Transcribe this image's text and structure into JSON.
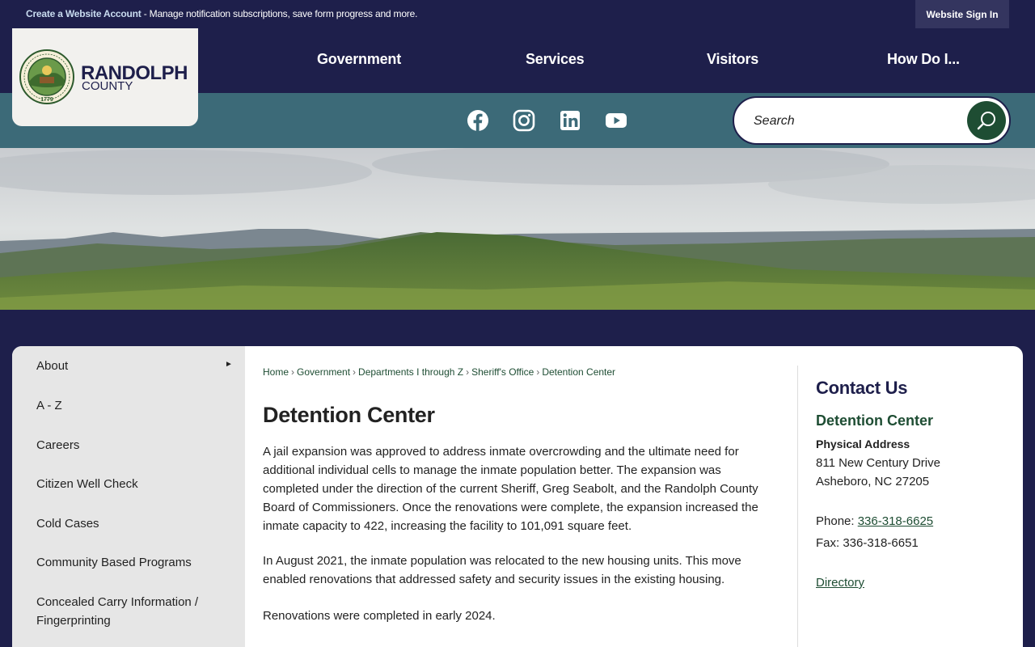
{
  "topbar": {
    "account_link": "Create a Website Account",
    "account_message": " - Manage notification subscriptions, save form progress and more.",
    "signin_label": "Website Sign In"
  },
  "logo": {
    "name": "RANDOLPH",
    "subname": "COUNTY",
    "seal_text": "RANDOLPH COUNTY, NORTH CAROLINA",
    "seal_year": "1779"
  },
  "nav": {
    "items": [
      {
        "label": "Government"
      },
      {
        "label": "Services"
      },
      {
        "label": "Visitors"
      },
      {
        "label": "How Do I..."
      }
    ]
  },
  "social": {
    "icons": [
      "facebook-icon",
      "instagram-icon",
      "linkedin-icon",
      "youtube-icon"
    ]
  },
  "search": {
    "placeholder": "Search"
  },
  "sidebar": {
    "items": [
      {
        "label": "About",
        "has_submenu": true
      },
      {
        "label": "A - Z"
      },
      {
        "label": "Careers"
      },
      {
        "label": "Citizen Well Check"
      },
      {
        "label": "Cold Cases"
      },
      {
        "label": "Community Based Programs"
      },
      {
        "label": "Concealed Carry Information / Fingerprinting"
      }
    ]
  },
  "breadcrumb": {
    "items": [
      "Home",
      "Government",
      "Departments I through Z",
      "Sheriff's Office",
      "Detention Center"
    ],
    "separator": "›"
  },
  "main": {
    "title": "Detention Center",
    "paragraphs": [
      "A jail expansion was approved to address inmate overcrowding and the ultimate need for additional individual cells to manage the inmate population better. The expansion was completed under the direction of the current Sheriff, Greg Seabolt, and the Randolph County Board of Commissioners. Once the renovations were complete, the expansion increased the inmate capacity to 422, increasing the facility to 101,091 square feet.",
      "In August 2021, the inmate population was relocated to the new housing units. This move enabled renovations that addressed safety and security issues in the existing housing.",
      "Renovations were completed in early 2024."
    ]
  },
  "contact": {
    "heading": "Contact Us",
    "department": "Detention Center",
    "address_label": "Physical Address",
    "address_line1": "811 New Century Drive",
    "address_line2": "Asheboro, NC 27205",
    "phone_label": "Phone: ",
    "phone": "336-318-6625",
    "fax_label": "Fax: ",
    "fax": "336-318-6651",
    "directory_label": "Directory"
  },
  "colors": {
    "navy": "#1e1f4b",
    "teal": "#3c6a78",
    "green": "#1e4d33",
    "sidebar_bg": "#e6e6e6"
  }
}
